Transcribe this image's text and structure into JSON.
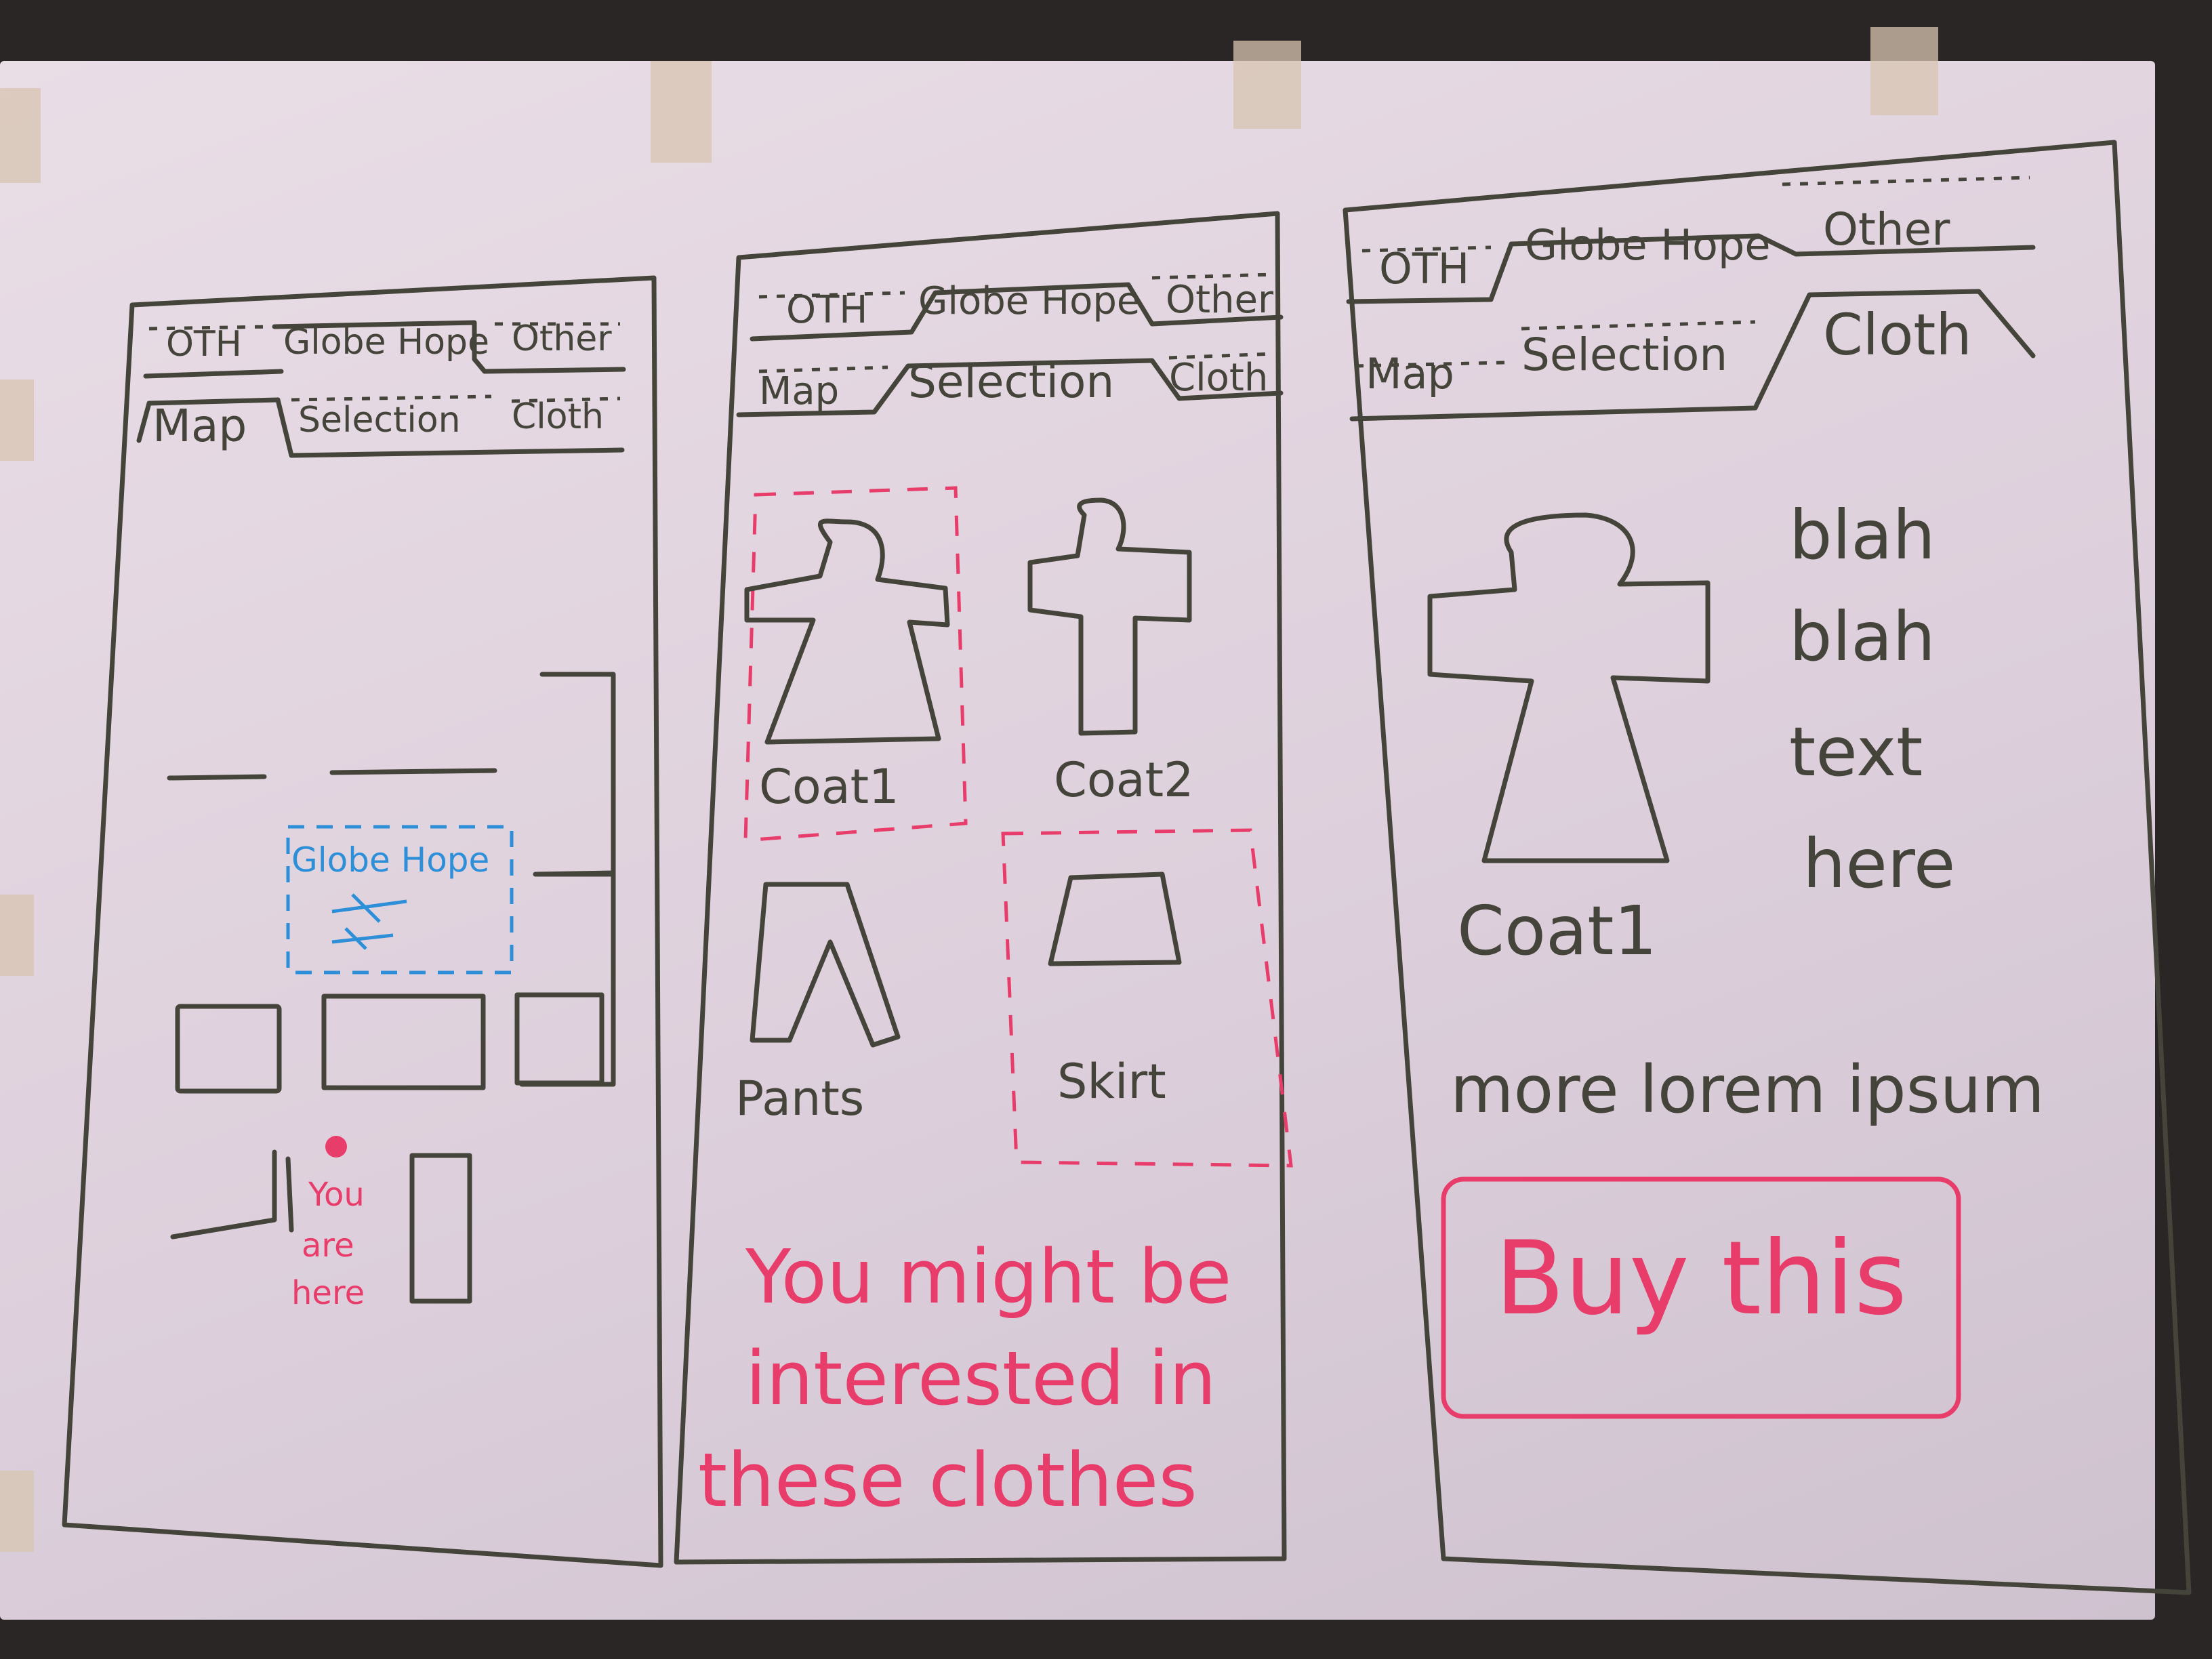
{
  "colors": {
    "ink": "#44443a",
    "accent_red": "#e83c6a",
    "accent_blue": "#2e8fd9",
    "board": "#e5d9e3"
  },
  "screen1": {
    "tabs_top": [
      "OTH",
      "Globe Hope",
      "Other"
    ],
    "tabs_bottom": [
      "Map",
      "Selection",
      "Cloth"
    ],
    "map": {
      "store_label": "Globe Hope",
      "store_icon": "scissors-icon",
      "you_are_here": [
        "You",
        "are",
        "here"
      ]
    }
  },
  "screen2": {
    "tabs_top": [
      "OTH",
      "Globe Hope",
      "Other"
    ],
    "tabs_bottom": [
      "Map",
      "Selection",
      "Cloth"
    ],
    "items": [
      {
        "label": "Coat1",
        "icon": "coat-icon"
      },
      {
        "label": "Coat2",
        "icon": "cross-coat-icon"
      },
      {
        "label": "Pants",
        "icon": "pants-icon"
      },
      {
        "label": "Skirt",
        "icon": "skirt-icon"
      }
    ],
    "suggestion": [
      "You might be",
      "interested in",
      "these clothes"
    ]
  },
  "screen3": {
    "tabs_top": [
      "OTH",
      "Globe Hope",
      "Other"
    ],
    "tabs_bottom": [
      "Map",
      "Selection",
      "Cloth"
    ],
    "item_label": "Coat1",
    "description": [
      "blah",
      "blah",
      "text",
      "here"
    ],
    "more_text": "more lorem ipsum",
    "buy_label": "Buy this"
  }
}
